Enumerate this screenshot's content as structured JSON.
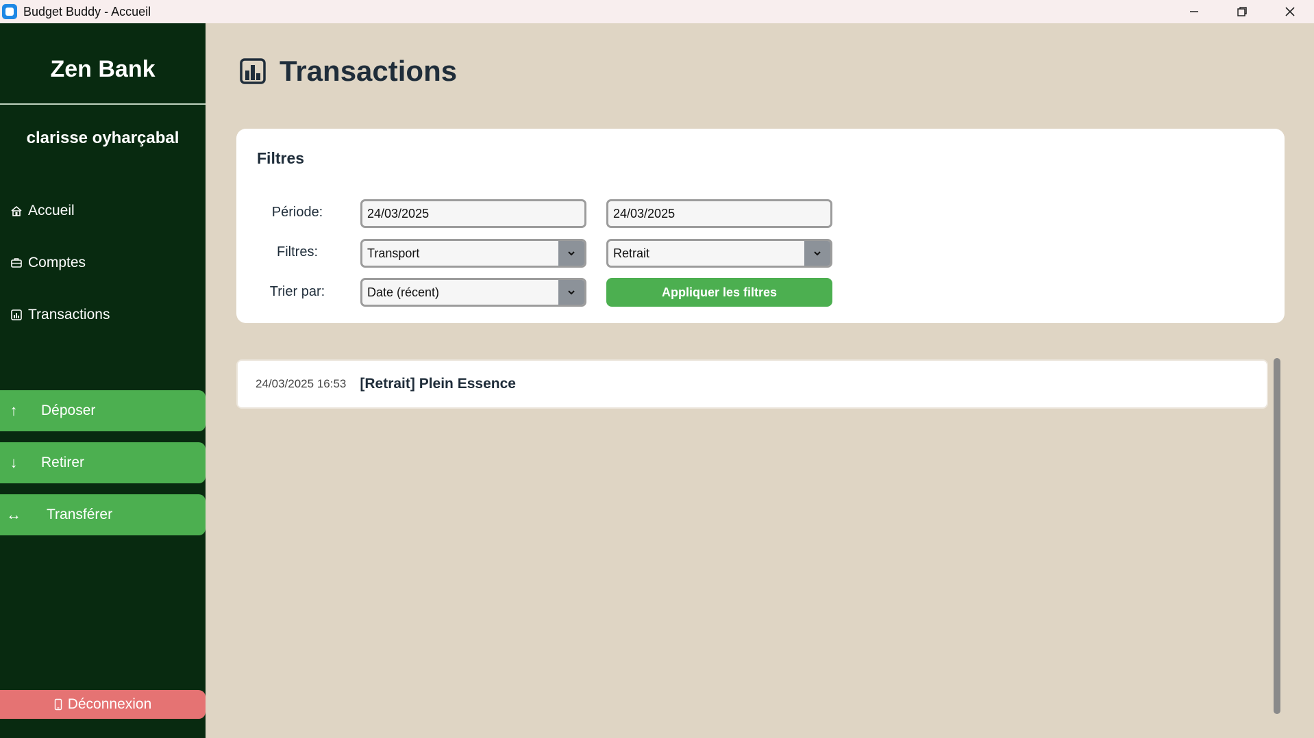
{
  "window": {
    "title": "Budget Buddy - Accueil"
  },
  "sidebar": {
    "brand": "Zen Bank",
    "username": "clarisse oyharçabal",
    "nav": [
      {
        "label": "Accueil",
        "icon": "home-icon"
      },
      {
        "label": "Comptes",
        "icon": "briefcase-icon"
      },
      {
        "label": "Transactions",
        "icon": "bar-chart-icon"
      }
    ],
    "actions": [
      {
        "label": "Déposer",
        "icon": "↑"
      },
      {
        "label": "Retirer",
        "icon": "↓"
      },
      {
        "label": "Transférer",
        "icon": "↔"
      }
    ],
    "logout": "Déconnexion"
  },
  "main": {
    "title": "Transactions",
    "filters": {
      "card_title": "Filtres",
      "period_label": "Période:",
      "start_date": "24/03/2025",
      "end_date": "24/03/2025",
      "filters_label": "Filtres:",
      "category": "Transport",
      "type": "Retrait",
      "sort_label": "Trier par:",
      "sort": "Date (récent)",
      "apply": "Appliquer les filtres"
    },
    "transactions": [
      {
        "datetime": "24/03/2025 16:53",
        "description": "[Retrait] Plein Essence"
      }
    ]
  },
  "colors": {
    "sidebar_bg": "#082a10",
    "accent_green": "#4caf50",
    "logout_red": "#e57373",
    "main_bg": "#dfd5c4"
  }
}
